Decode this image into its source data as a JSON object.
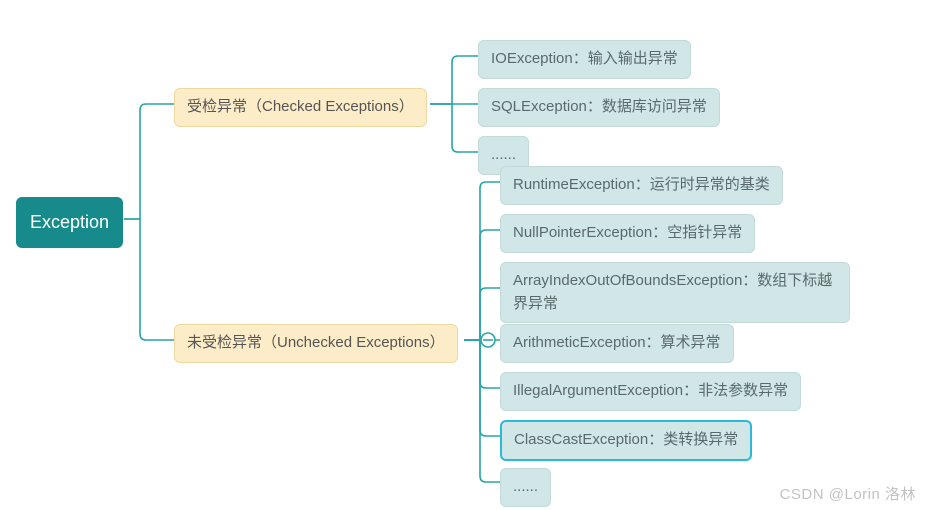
{
  "root": {
    "label": "Exception"
  },
  "branches": [
    {
      "id": "checked",
      "label": "受检异常（Checked Exceptions）",
      "children": [
        {
          "label": "IOException：输入输出异常"
        },
        {
          "label": "SQLException：数据库访问异常"
        },
        {
          "label": "......"
        }
      ]
    },
    {
      "id": "unchecked",
      "label": "未受检异常（Unchecked Exceptions）",
      "children": [
        {
          "label": "RuntimeException：运行时异常的基类"
        },
        {
          "label": "NullPointerException：空指针异常"
        },
        {
          "label": "ArrayIndexOutOfBoundsException：数组下标越界异常",
          "wrap": true
        },
        {
          "label": "ArithmeticException：算术异常"
        },
        {
          "label": "IllegalArgumentException：非法参数异常"
        },
        {
          "label": "ClassCastException：类转换异常",
          "selected": true
        },
        {
          "label": "......"
        }
      ]
    }
  ],
  "watermark": "CSDN @Lorin 洛林",
  "colors": {
    "line": "#2aa5a5",
    "root_bg": "#178b8b",
    "branch_bg": "#fdecc8",
    "leaf_bg": "#d1e6e6",
    "selected_border": "#2bb9d9"
  }
}
